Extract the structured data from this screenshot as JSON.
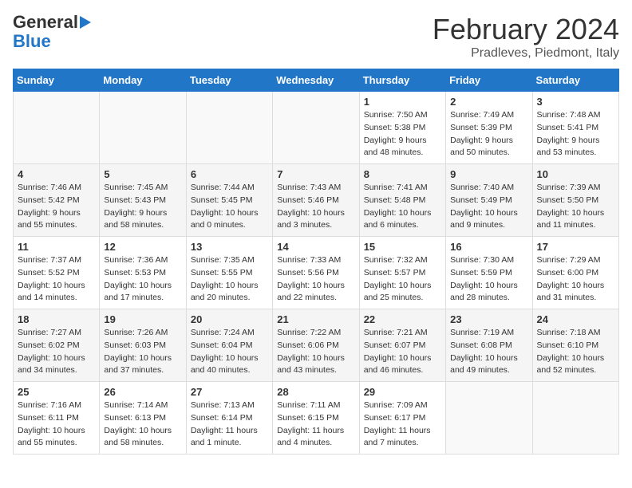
{
  "header": {
    "logo_line1": "General",
    "logo_line2": "Blue",
    "month": "February 2024",
    "location": "Pradleves, Piedmont, Italy"
  },
  "days_of_week": [
    "Sunday",
    "Monday",
    "Tuesday",
    "Wednesday",
    "Thursday",
    "Friday",
    "Saturday"
  ],
  "weeks": [
    [
      {
        "day": "",
        "info": ""
      },
      {
        "day": "",
        "info": ""
      },
      {
        "day": "",
        "info": ""
      },
      {
        "day": "",
        "info": ""
      },
      {
        "day": "1",
        "info": "Sunrise: 7:50 AM\nSunset: 5:38 PM\nDaylight: 9 hours\nand 48 minutes."
      },
      {
        "day": "2",
        "info": "Sunrise: 7:49 AM\nSunset: 5:39 PM\nDaylight: 9 hours\nand 50 minutes."
      },
      {
        "day": "3",
        "info": "Sunrise: 7:48 AM\nSunset: 5:41 PM\nDaylight: 9 hours\nand 53 minutes."
      }
    ],
    [
      {
        "day": "4",
        "info": "Sunrise: 7:46 AM\nSunset: 5:42 PM\nDaylight: 9 hours\nand 55 minutes."
      },
      {
        "day": "5",
        "info": "Sunrise: 7:45 AM\nSunset: 5:43 PM\nDaylight: 9 hours\nand 58 minutes."
      },
      {
        "day": "6",
        "info": "Sunrise: 7:44 AM\nSunset: 5:45 PM\nDaylight: 10 hours\nand 0 minutes."
      },
      {
        "day": "7",
        "info": "Sunrise: 7:43 AM\nSunset: 5:46 PM\nDaylight: 10 hours\nand 3 minutes."
      },
      {
        "day": "8",
        "info": "Sunrise: 7:41 AM\nSunset: 5:48 PM\nDaylight: 10 hours\nand 6 minutes."
      },
      {
        "day": "9",
        "info": "Sunrise: 7:40 AM\nSunset: 5:49 PM\nDaylight: 10 hours\nand 9 minutes."
      },
      {
        "day": "10",
        "info": "Sunrise: 7:39 AM\nSunset: 5:50 PM\nDaylight: 10 hours\nand 11 minutes."
      }
    ],
    [
      {
        "day": "11",
        "info": "Sunrise: 7:37 AM\nSunset: 5:52 PM\nDaylight: 10 hours\nand 14 minutes."
      },
      {
        "day": "12",
        "info": "Sunrise: 7:36 AM\nSunset: 5:53 PM\nDaylight: 10 hours\nand 17 minutes."
      },
      {
        "day": "13",
        "info": "Sunrise: 7:35 AM\nSunset: 5:55 PM\nDaylight: 10 hours\nand 20 minutes."
      },
      {
        "day": "14",
        "info": "Sunrise: 7:33 AM\nSunset: 5:56 PM\nDaylight: 10 hours\nand 22 minutes."
      },
      {
        "day": "15",
        "info": "Sunrise: 7:32 AM\nSunset: 5:57 PM\nDaylight: 10 hours\nand 25 minutes."
      },
      {
        "day": "16",
        "info": "Sunrise: 7:30 AM\nSunset: 5:59 PM\nDaylight: 10 hours\nand 28 minutes."
      },
      {
        "day": "17",
        "info": "Sunrise: 7:29 AM\nSunset: 6:00 PM\nDaylight: 10 hours\nand 31 minutes."
      }
    ],
    [
      {
        "day": "18",
        "info": "Sunrise: 7:27 AM\nSunset: 6:02 PM\nDaylight: 10 hours\nand 34 minutes."
      },
      {
        "day": "19",
        "info": "Sunrise: 7:26 AM\nSunset: 6:03 PM\nDaylight: 10 hours\nand 37 minutes."
      },
      {
        "day": "20",
        "info": "Sunrise: 7:24 AM\nSunset: 6:04 PM\nDaylight: 10 hours\nand 40 minutes."
      },
      {
        "day": "21",
        "info": "Sunrise: 7:22 AM\nSunset: 6:06 PM\nDaylight: 10 hours\nand 43 minutes."
      },
      {
        "day": "22",
        "info": "Sunrise: 7:21 AM\nSunset: 6:07 PM\nDaylight: 10 hours\nand 46 minutes."
      },
      {
        "day": "23",
        "info": "Sunrise: 7:19 AM\nSunset: 6:08 PM\nDaylight: 10 hours\nand 49 minutes."
      },
      {
        "day": "24",
        "info": "Sunrise: 7:18 AM\nSunset: 6:10 PM\nDaylight: 10 hours\nand 52 minutes."
      }
    ],
    [
      {
        "day": "25",
        "info": "Sunrise: 7:16 AM\nSunset: 6:11 PM\nDaylight: 10 hours\nand 55 minutes."
      },
      {
        "day": "26",
        "info": "Sunrise: 7:14 AM\nSunset: 6:13 PM\nDaylight: 10 hours\nand 58 minutes."
      },
      {
        "day": "27",
        "info": "Sunrise: 7:13 AM\nSunset: 6:14 PM\nDaylight: 11 hours\nand 1 minute."
      },
      {
        "day": "28",
        "info": "Sunrise: 7:11 AM\nSunset: 6:15 PM\nDaylight: 11 hours\nand 4 minutes."
      },
      {
        "day": "29",
        "info": "Sunrise: 7:09 AM\nSunset: 6:17 PM\nDaylight: 11 hours\nand 7 minutes."
      },
      {
        "day": "",
        "info": ""
      },
      {
        "day": "",
        "info": ""
      }
    ]
  ]
}
